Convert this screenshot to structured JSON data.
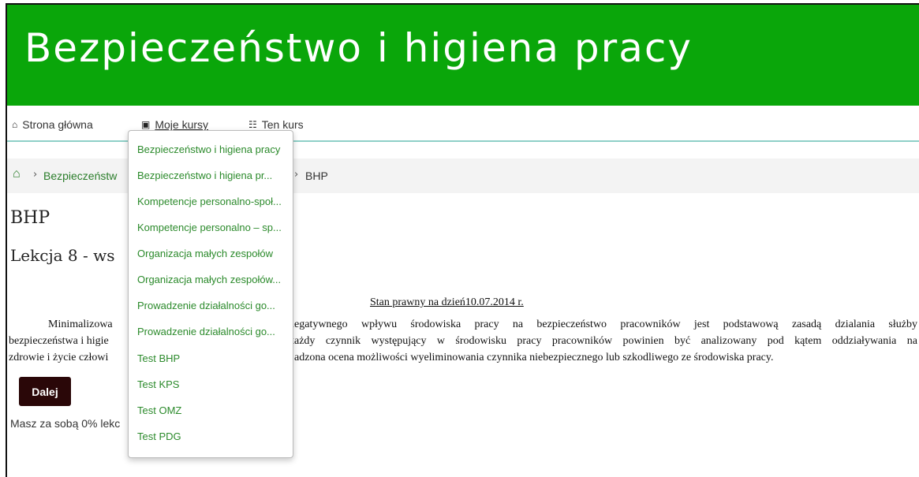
{
  "site": {
    "title": "Bezpieczeństwo i higiena pracy"
  },
  "nav": {
    "home_label": "Strona główna",
    "my_courses_label": "Moje kursy",
    "this_course_label": "Ten kurs",
    "home_icon": "home-icon",
    "my_courses_icon": "briefcase-icon",
    "this_course_icon": "sitemap-icon"
  },
  "breadcrumb": {
    "items": [
      "Bezpieczeństw",
      "BHP"
    ]
  },
  "dropdown": {
    "items": [
      "Bezpieczeństwo i higiena pracy",
      "Bezpieczeństwo i higiena pr...",
      "Kompetencje personalno-społ...",
      "Kompetencje personalno – sp...",
      "Organizacja małych zespołów",
      "Organizacja małych zespołów...",
      "Prowadzenie działalności go...",
      "Prowadzenie działalności go...",
      "Test BHP",
      "Test KPS",
      "Test OMZ",
      "Test PDG"
    ]
  },
  "main": {
    "page_title": "BHP",
    "lesson_title": "Lekcja 8 - ws",
    "legal_status": "Stan prawny na dzień10.07.2014 r.",
    "paragraph": "Minimalizowa... negatywnego wpływu środowiska pracy na bezpieczeństwo pracowników jest podstawową zasadą dzialania służby bezpieczeństwa i higie... każdy czynnik występujący w środowisku pracy pracowników powinien być analizowany pod kątem oddziaływania na zdrowie i życie człowi... adzona ocena możliwości wyeliminowania czynnika niebezpiecznego lub szkodliwego ze środowiska pracy.",
    "paragraph_lines": [
      "Minimalizowa",
      "negatywnego wpływu środowiska pracy na bezpieczeństwo pracowników jest podstawową zasadą dzialania służby",
      "bezpieczeństwa i higie",
      "każdy czynnik występujący w środowisku pracy pracowników powinien być analizowany pod kątem oddziaływania na",
      "zdrowie i życie człowi",
      "adzona ocena możliwości wyeliminowania czynnika niebezpiecznego lub szkodliwego ze środowiska pracy."
    ],
    "next_button": "Dalej",
    "progress_text": "Masz za sobą 0% lekc",
    "progress_percent": 0
  },
  "colors": {
    "banner": "#0aa60a",
    "link": "#2b8a2b",
    "button": "#2a0708"
  }
}
